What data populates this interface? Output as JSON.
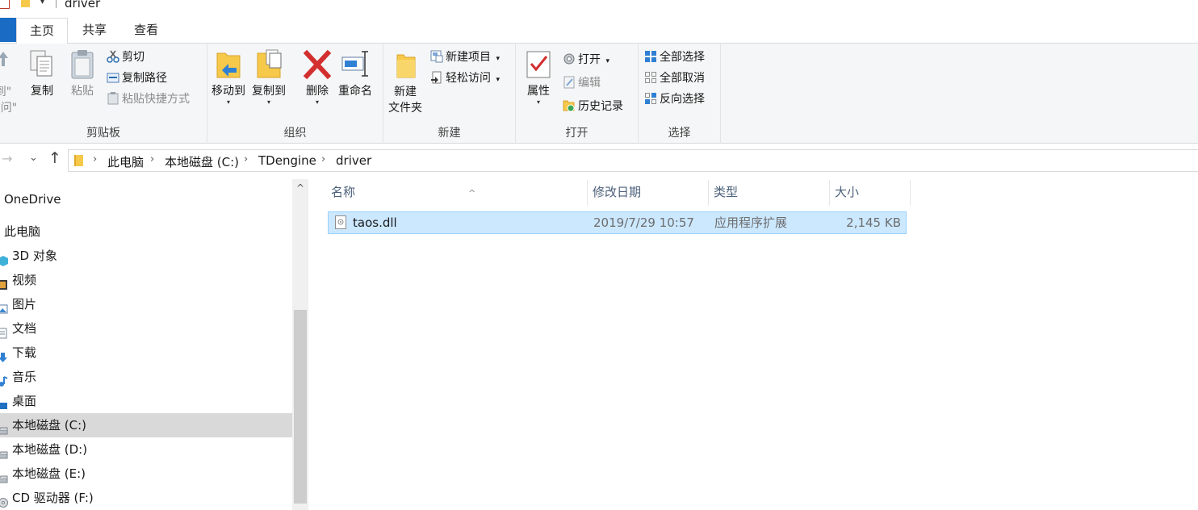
{
  "window": {
    "title": "driver"
  },
  "ribbon_tabs": [
    {
      "label": "主页",
      "active": true
    },
    {
      "label": "共享",
      "active": false
    },
    {
      "label": "查看",
      "active": false
    }
  ],
  "clipboard": {
    "pin_label_line1": "到\"",
    "pin_label_line2": "访问\"",
    "copy": "复制",
    "paste": "粘贴",
    "cut": "剪切",
    "copy_path": "复制路径",
    "paste_shortcut": "粘贴快捷方式",
    "group": "剪贴板"
  },
  "organize": {
    "move_to": "移动到",
    "copy_to": "复制到",
    "delete": "删除",
    "rename": "重命名",
    "group": "组织"
  },
  "new": {
    "new_folder_line1": "新建",
    "new_folder_line2": "文件夹",
    "new_item": "新建项目",
    "easy_access": "轻松访问",
    "group": "新建"
  },
  "open": {
    "properties": "属性",
    "open": "打开",
    "edit": "编辑",
    "history": "历史记录",
    "group": "打开"
  },
  "select": {
    "select_all": "全部选择",
    "select_none": "全部取消",
    "invert": "反向选择",
    "group": "选择"
  },
  "address": {
    "crumbs": [
      "此电脑",
      "本地磁盘 (C:)",
      "TDengine",
      "driver"
    ]
  },
  "nav_tree": [
    {
      "label": "OneDrive",
      "selected": false,
      "icon": "onedrive-icon"
    },
    {
      "label": "此电脑",
      "selected": false,
      "icon": "this-pc-icon"
    },
    {
      "label": "3D 对象",
      "selected": false,
      "icon": "3d-objects-icon"
    },
    {
      "label": "视频",
      "selected": false,
      "icon": "videos-icon"
    },
    {
      "label": "图片",
      "selected": false,
      "icon": "pictures-icon"
    },
    {
      "label": "文档",
      "selected": false,
      "icon": "documents-icon"
    },
    {
      "label": "下载",
      "selected": false,
      "icon": "downloads-icon"
    },
    {
      "label": "音乐",
      "selected": false,
      "icon": "music-icon"
    },
    {
      "label": "桌面",
      "selected": false,
      "icon": "desktop-icon"
    },
    {
      "label": "本地磁盘 (C:)",
      "selected": true,
      "icon": "drive-icon"
    },
    {
      "label": "本地磁盘 (D:)",
      "selected": false,
      "icon": "drive-icon"
    },
    {
      "label": "本地磁盘 (E:)",
      "selected": false,
      "icon": "drive-icon"
    },
    {
      "label": "CD 驱动器 (F:)",
      "selected": false,
      "icon": "cd-drive-icon"
    }
  ],
  "columns": {
    "name": "名称",
    "modified": "修改日期",
    "type": "类型",
    "size": "大小"
  },
  "files": [
    {
      "name": "taos.dll",
      "modified": "2019/7/29 10:57",
      "type": "应用程序扩展",
      "size": "2,145 KB",
      "selected": true
    }
  ],
  "colors": {
    "accent": "#1a6bc4",
    "selection": "#cce8ff",
    "selection_border": "#99d1ff",
    "delete_red": "#d32f2f",
    "folder_yellow": "#f6c94a"
  }
}
